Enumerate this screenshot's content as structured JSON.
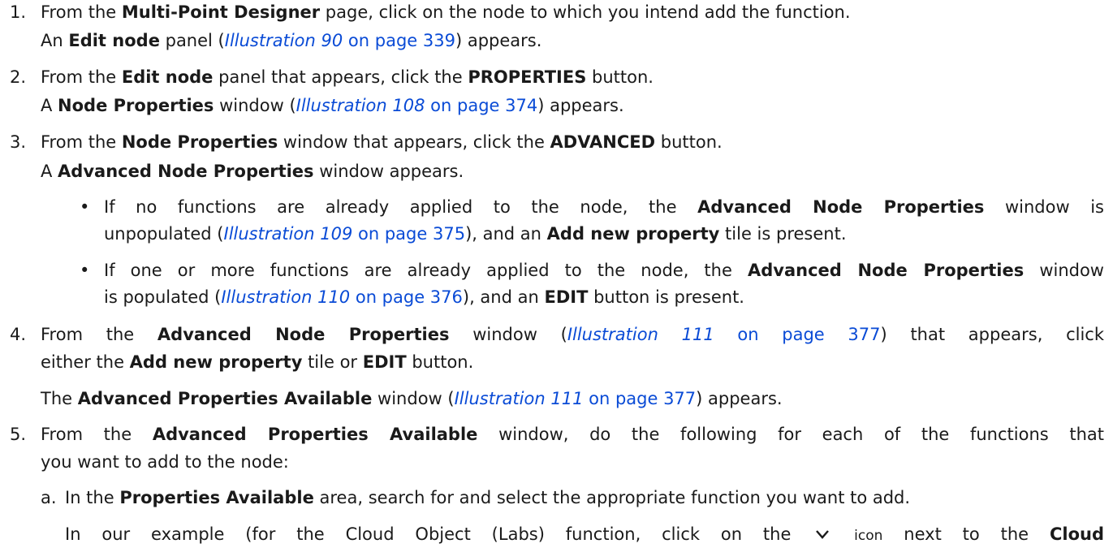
{
  "steps": [
    {
      "number": "1.",
      "p1": "From the ",
      "b1": "Multi-Point Designer",
      "p2": " page, click on the node to which you intend add the function.",
      "r_p1": "An ",
      "r_b1": "Edit node",
      "r_p2": " panel (",
      "r_illus": "Illustration 90",
      "r_on": " on page 339",
      "r_p3": ") appears."
    },
    {
      "number": "2.",
      "p1": "From the ",
      "b1": "Edit node",
      "p2": " panel that appears, click the ",
      "b2": "PROPERTIES",
      "p3": " button.",
      "r_p1": "A ",
      "r_b1": "Node Properties",
      "r_p2": " window (",
      "r_illus": "Illustration 108",
      "r_on": " on page 374",
      "r_p3": ") appears."
    },
    {
      "number": "3.",
      "p1": "From the ",
      "b1": "Node Properties",
      "p2": " window that appears, click the ",
      "b2": "ADVANCED",
      "p3": " button.",
      "r_p1": "A ",
      "r_b1": "Advanced Node Properties",
      "r_p2": " window appears.",
      "bullets": [
        {
          "l1_p1": "If no functions are already applied to the node, the ",
          "l1_b1": "Advanced Node Properties",
          "l1_p2": " window is",
          "l2_p1": "unpopulated (",
          "l2_illus": "Illustration 109",
          "l2_on": " on page 375",
          "l2_p2": "), and an ",
          "l2_b1": "Add new property",
          "l2_p3": " tile is present."
        },
        {
          "l1_p1": "If one or more functions are already applied to the node, the ",
          "l1_b1": "Advanced Node Properties",
          "l1_p2": " window",
          "l2_p1": "is populated (",
          "l2_illus": "Illustration 110",
          "l2_on": " on page 376",
          "l2_p2": "), and an ",
          "l2_b1": "EDIT",
          "l2_p3": " button is present."
        }
      ]
    },
    {
      "number": "4.",
      "p1": "From the ",
      "b1": "Advanced Node Properties",
      "p2": " window (",
      "illus": "Illustration 111",
      "on": " on page 377",
      "p3": ") that appears, click",
      "l2_p1": "either the ",
      "l2_b1": "Add new property",
      "l2_p2": " tile or ",
      "l2_b2": "EDIT",
      "l2_p3": " button.",
      "r_p1": "The ",
      "r_b1": "Advanced Properties Available",
      "r_p2": " window (",
      "r_illus": "Illustration 111",
      "r_on": " on page 377",
      "r_p3": ") appears."
    },
    {
      "number": "5.",
      "p1": "From the ",
      "b1": "Advanced Properties Available",
      "p2": " window, do the following for each of the functions that",
      "l2": "you want to add to the node:",
      "sub": {
        "letter": "a.",
        "p1": "In the ",
        "b1": "Properties Available",
        "p2": " area, search for and select the appropriate function you want to add.",
        "n_p1": "In our example (for the Cloud Object (Labs) function, click on the",
        "n_icon": "chevron-down",
        "n_small": "icon",
        "n_p2": " next to the ",
        "n_b1": "Cloud"
      }
    }
  ]
}
